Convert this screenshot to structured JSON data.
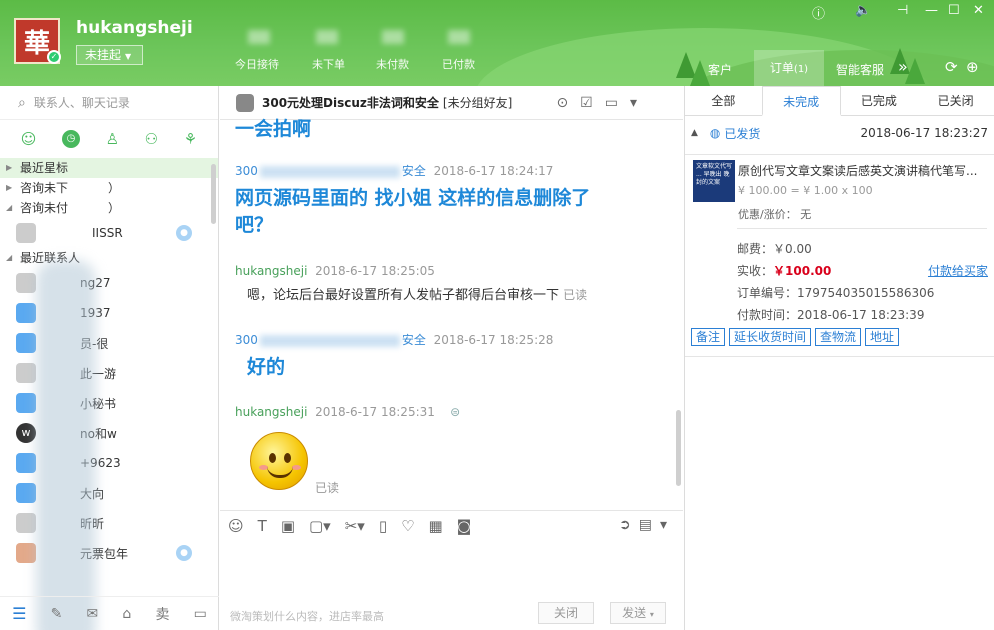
{
  "header": {
    "username": "hukangsheji",
    "status": "未挂起",
    "stats": [
      "今日接待",
      "未下单",
      "未付款",
      "已付款"
    ],
    "tabs": [
      "客户",
      "订单",
      "智能客服"
    ],
    "order_badge": "(1)",
    "more": "»"
  },
  "left": {
    "search_placeholder": "联系人、聊天记录",
    "groups": [
      {
        "label": "最近星标",
        "selected": true
      },
      {
        "label": "咨询未下",
        "suffix": "）"
      },
      {
        "label": "咨询未付",
        "suffix": "）"
      }
    ],
    "contacts_a": [
      {
        "name": "IISSR",
        "avatar": "gray",
        "badge": true
      }
    ],
    "group_recent": "最近联系人",
    "contacts_b": [
      {
        "name": "ng27",
        "avatar": "gray"
      },
      {
        "name": "1937",
        "avatar": "blue"
      },
      {
        "name": "员-很",
        "avatar": "blue"
      },
      {
        "name": "此一游",
        "avatar": "gray"
      },
      {
        "name": "小秘书",
        "avatar": "blue"
      },
      {
        "name": "no和w",
        "avatar": "dark"
      },
      {
        "name": "+9623",
        "avatar": "blue"
      },
      {
        "name": "大向",
        "avatar": "blue"
      },
      {
        "name": "昕昕",
        "avatar": "gray"
      },
      {
        "name": "元票包年",
        "avatar": "photo",
        "badge": true
      }
    ],
    "footer_icons": [
      "menu-icon",
      "edit-icon",
      "mail-icon",
      "shop-icon",
      "sell-icon",
      "window-icon"
    ],
    "footer_sell": "卖"
  },
  "chat": {
    "title": "300元处理Discuz非法词和安全",
    "tag": "[未分组好友]",
    "messages": [
      {
        "prefix": "",
        "text": "一会拍啊",
        "kind": "big"
      },
      {
        "sender": "300",
        "suffix": "安全",
        "time": "2018-6-17 18:24:17",
        "text": "网页源码里面的 找小姐 这样的信息删除了吧？",
        "kind": "big"
      },
      {
        "sender": "hukangsheji",
        "time": "2018-6-17 18:25:05",
        "text": "嗯，论坛后台最好设置所有人发帖子都得后台审核一下",
        "read": "已读",
        "kind": "normal"
      },
      {
        "sender": "300",
        "suffix": "安全",
        "time": "2018-6-17 18:25:28",
        "text": "好的",
        "kind": "big"
      },
      {
        "sender": "hukangsheji",
        "time": "2018-6-17 18:25:31",
        "read": "已读",
        "kind": "emoji"
      }
    ],
    "input_placeholder": "微淘策划什么内容，进店率最高",
    "close_label": "关闭",
    "send_label": "发送"
  },
  "right": {
    "tabs": [
      "全部",
      "未完成",
      "已完成",
      "已关闭"
    ],
    "active_tab": "未完成",
    "order": {
      "status": "已发货",
      "time": "2018-06-17 18:23:27",
      "product_title": "原创代写文章文案读后感英文演讲稿代笔写...",
      "product_thumb_text": "文章软文代写 ... 早晚出 晚封的文案",
      "price_line": "¥ 100.00 = ¥ 1.00 x 100",
      "discount": "优惠/涨价： 无",
      "shipping": "邮费：￥0.00",
      "received_label": "实收：",
      "received": "￥100.00",
      "pay_link": "付款给买家",
      "order_no": "订单编号：179754035015586306",
      "pay_time": "付款时间：2018-06-17 18:23:39",
      "actions": [
        "备注",
        "延长收货时间",
        "查物流",
        "地址"
      ]
    }
  }
}
